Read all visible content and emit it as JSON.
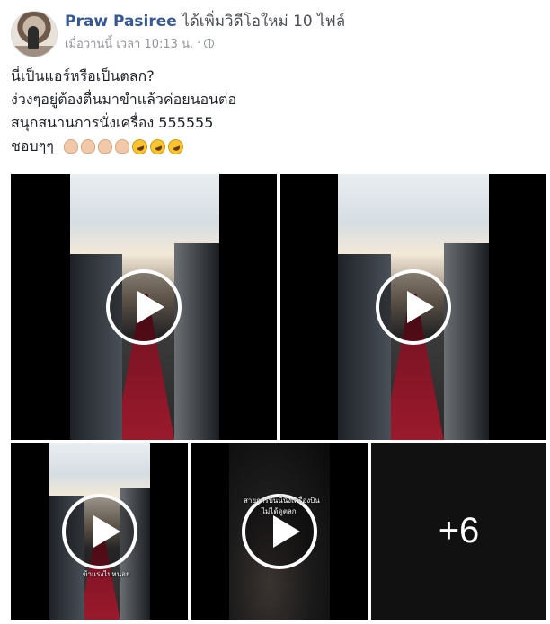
{
  "post": {
    "author": "Praw Pasiree",
    "action": "ได้เพิ่มวิดีโอใหม่ 10 ไฟล์",
    "time": "เมื่อวานนี้ เวลา 10:13 น.",
    "separator": "·",
    "privacy_icon": "globe-icon",
    "lines": [
      "นี่เป็นแอร์หรือเป็นตลก?",
      "ง่วงๆอยู่ต้องตื่นมาขำแล้วค่อยนอนต่อ",
      "สนุกสนานการนั่งเครื่อง 555555",
      "ชอบๆๆ"
    ],
    "emojis": [
      "clapping-hands-icon",
      "clapping-hands-icon",
      "clapping-hands-icon",
      "clapping-hands-icon",
      "rolling-laughing-icon",
      "rolling-laughing-icon",
      "rolling-laughing-icon"
    ]
  },
  "videos": {
    "caption_3": "ข้าแรงไปหน่อย",
    "caption_4a": "สายการบินนี้นั่งเครื่องบิน",
    "caption_4b": "ไม่ได้ดูตลก",
    "more_count": "+6"
  },
  "colors": {
    "link": "#365899",
    "meta": "#90949c"
  }
}
